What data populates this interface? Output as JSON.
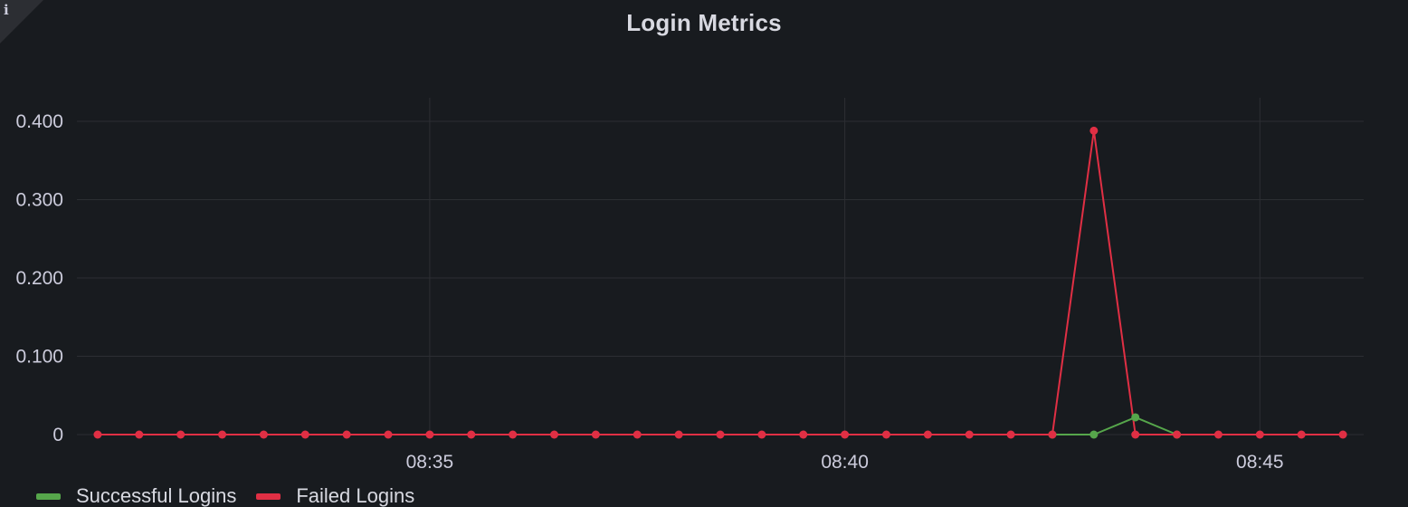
{
  "panel": {
    "title": "Login Metrics",
    "info_glyph": "i",
    "info_icon": "info-icon"
  },
  "theme": {
    "background": "#181b1f",
    "grid": "#2c2e33",
    "text": "#ccccdc",
    "successful_color": "#56a64b",
    "failed_color": "#e02f44"
  },
  "legend": {
    "items": [
      {
        "label": "Successful Logins",
        "color": "#56a64b"
      },
      {
        "label": "Failed Logins",
        "color": "#e02f44"
      }
    ]
  },
  "chart_data": {
    "type": "line",
    "title": "Login Metrics",
    "xlabel": "",
    "ylabel": "",
    "x_axis": "time",
    "x_range": [
      "08:30:45",
      "08:46:15"
    ],
    "x_ticks": [
      "08:35",
      "08:40",
      "08:45"
    ],
    "y_ticks": [
      "0",
      "0.100",
      "0.200",
      "0.300",
      "0.400"
    ],
    "ylim": [
      0,
      0.43
    ],
    "grid": true,
    "legend_position": "bottom-left",
    "x": [
      "08:31:00",
      "08:31:30",
      "08:32:00",
      "08:32:30",
      "08:33:00",
      "08:33:30",
      "08:34:00",
      "08:34:30",
      "08:35:00",
      "08:35:30",
      "08:36:00",
      "08:36:30",
      "08:37:00",
      "08:37:30",
      "08:38:00",
      "08:38:30",
      "08:39:00",
      "08:39:30",
      "08:40:00",
      "08:40:30",
      "08:41:00",
      "08:41:30",
      "08:42:00",
      "08:42:30",
      "08:43:00",
      "08:43:30",
      "08:44:00",
      "08:44:30",
      "08:45:00",
      "08:45:30",
      "08:46:00"
    ],
    "series": [
      {
        "name": "Successful Logins",
        "color": "#56a64b",
        "values": [
          null,
          null,
          null,
          null,
          null,
          null,
          null,
          null,
          null,
          null,
          null,
          null,
          null,
          null,
          null,
          null,
          null,
          null,
          null,
          null,
          null,
          null,
          null,
          0,
          0,
          0.022,
          0,
          null,
          null,
          null,
          null
        ]
      },
      {
        "name": "Failed Logins",
        "color": "#e02f44",
        "values": [
          0,
          0,
          0,
          0,
          0,
          0,
          0,
          0,
          0,
          0,
          0,
          0,
          0,
          0,
          0,
          0,
          0,
          0,
          0,
          0,
          0,
          0,
          0,
          0,
          0.388,
          0,
          0,
          0,
          0,
          0,
          0
        ]
      }
    ]
  }
}
